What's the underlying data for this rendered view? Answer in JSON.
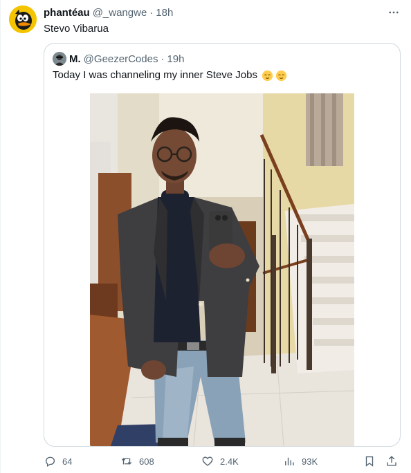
{
  "tweet": {
    "author_name": "phantéau",
    "author_handle": "@_wangwe",
    "separator": "·",
    "time": "18h",
    "text": "Stevo Vibarua"
  },
  "quote": {
    "author_name": "M.",
    "author_handle": "@GeezerCodes",
    "separator": "·",
    "time": "19h",
    "text": "Today I was channeling my inner Steve Jobs"
  },
  "actions": {
    "replies": "64",
    "reposts": "608",
    "likes": "2.4K",
    "views": "93K"
  },
  "icons": {
    "more": "more-horizontal-icon",
    "reply": "reply-icon",
    "repost": "repost-icon",
    "like": "heart-icon",
    "views": "views-chart-icon",
    "bookmark": "bookmark-icon",
    "share": "share-icon"
  },
  "colors": {
    "text": "#0f1419",
    "secondary": "#536471",
    "border": "#cfd9de",
    "avatar_bg": "#f4c400"
  }
}
